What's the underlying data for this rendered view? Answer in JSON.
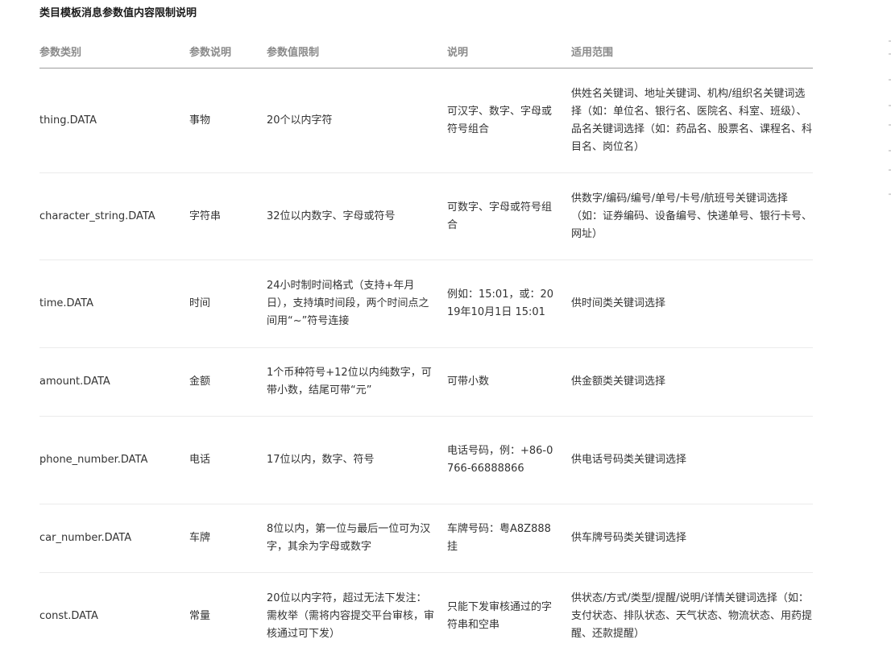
{
  "title": "类目模板消息参数值内容限制说明",
  "table": {
    "headers": [
      "参数类别",
      "参数说明",
      "参数值限制",
      "说明",
      "适用范围"
    ],
    "rows": [
      {
        "category": "thing.DATA",
        "desc": "事物",
        "limit": "20个以内字符",
        "note": "可汉字、数字、字母或符号组合",
        "scope": "供姓名关键词、地址关键词、机构/组织名关键词选择（如：单位名、银行名、医院名、科室、班级）、品名关键词选择（如：药品名、股票名、课程名、科目名、岗位名）"
      },
      {
        "category": "character_string.DATA",
        "desc": "字符串",
        "limit": "32位以内数字、字母或符号",
        "note": "可数字、字母或符号组合",
        "scope": "供数字/编码/编号/单号/卡号/航班号关键词选择（如：证券编码、设备编号、快递单号、银行卡号、网址）"
      },
      {
        "category": "time.DATA",
        "desc": "时间",
        "limit": "24小时制时间格式（支持+年月日），支持填时间段，两个时间点之间用“~”符号连接",
        "note": "例如：15:01，或：2019年10月1日 15:01",
        "scope": "供时间类关键词选择"
      },
      {
        "category": "amount.DATA",
        "desc": "金额",
        "limit": "1个币种符号+12位以内纯数字，可带小数，结尾可带“元”",
        "note": "可带小数",
        "scope": "供金额类关键词选择"
      },
      {
        "category": "phone_number.DATA",
        "desc": "电话",
        "limit": "17位以内，数字、符号",
        "note": "电话号码，例：+86-0766-66888866",
        "scope": "供电话号码类关键词选择"
      },
      {
        "category": "car_number.DATA",
        "desc": "车牌",
        "limit": "8位以内，第一位与最后一位可为汉字，其余为字母或数字",
        "note": "车牌号码：粤A8Z888挂",
        "scope": "供车牌号码类关键词选择"
      },
      {
        "category": "const.DATA",
        "desc": "常量",
        "limit": "20位以内字符，超过无法下发注：需枚举（需将内容提交平台审核，审核通过可下发）",
        "note": "只能下发审核通过的字符串和空串",
        "scope": "供状态/方式/类型/提醒/说明/详情关键词选择（如：支付状态、排队状态、天气状态、物流状态、用药提醒、还款提醒）"
      }
    ]
  }
}
